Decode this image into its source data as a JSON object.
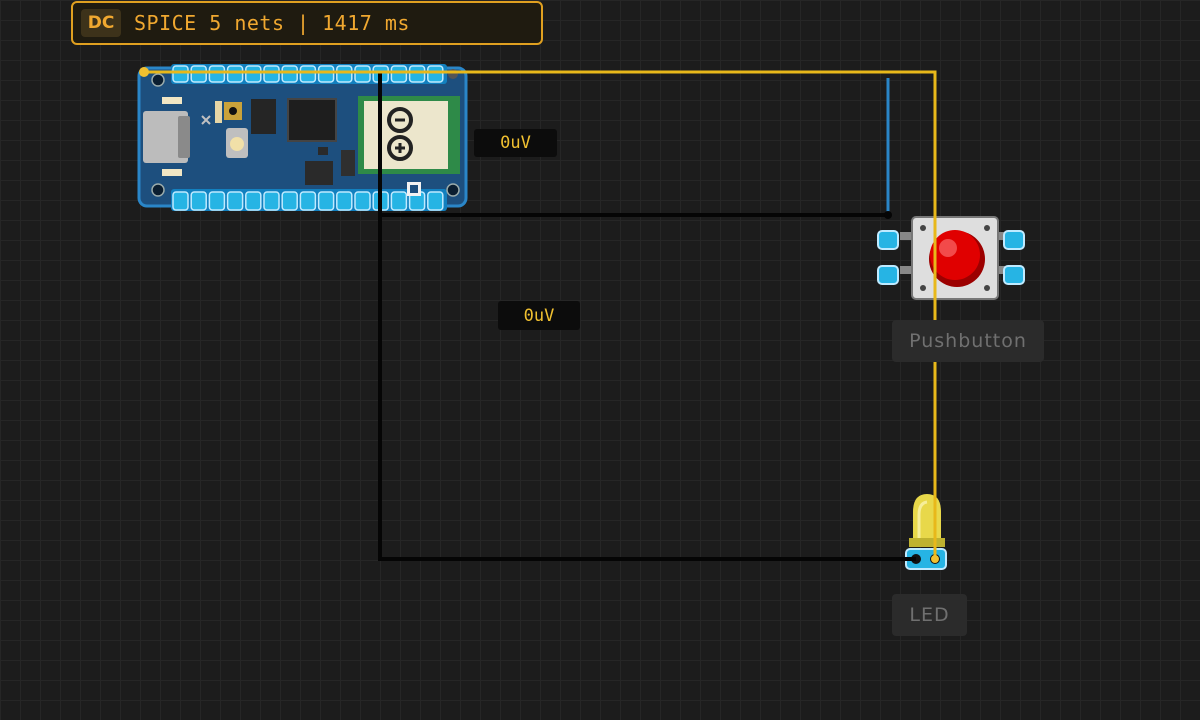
{
  "status": {
    "mode": "DC",
    "text": "SPICE 5 nets | 1417 ms"
  },
  "probes": [
    {
      "value": "0uV"
    },
    {
      "value": "0uV"
    }
  ],
  "components": {
    "board": {
      "icon": "arduino-logo-icon"
    },
    "pushbutton": {
      "label": "Pushbutton"
    },
    "led": {
      "label": "LED"
    }
  },
  "colors": {
    "accent": "#e0a020",
    "wire_yellow": "#e8b81a",
    "wire_blue": "#2a86c8",
    "wire_black": "#050505",
    "pin_cyan": "#26b4e4",
    "board_blue": "#1d4f7e"
  }
}
